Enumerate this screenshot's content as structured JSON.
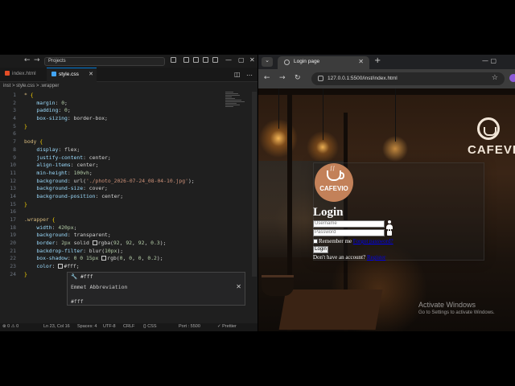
{
  "editor": {
    "search_placeholder": "Projects",
    "tabs": [
      {
        "label": "index.html",
        "icon": "html-file-icon",
        "color": "#e44d26"
      },
      {
        "label": "style.css",
        "icon": "css-file-icon",
        "color": "#42a5f5"
      }
    ],
    "breadcrumb": "inst > style.css > .wrapper",
    "code_lines": [
      {
        "n": "1",
        "t": "* {"
      },
      {
        "n": "2",
        "t": "    margin: 0;"
      },
      {
        "n": "3",
        "t": "    padding: 0;"
      },
      {
        "n": "4",
        "t": "    box-sizing: border-box;"
      },
      {
        "n": "5",
        "t": "}"
      },
      {
        "n": "6",
        "t": ""
      },
      {
        "n": "7",
        "t": "body {"
      },
      {
        "n": "8",
        "t": "    display: flex;"
      },
      {
        "n": "9",
        "t": "    justify-content: center;"
      },
      {
        "n": "10",
        "t": "    align-items: center;"
      },
      {
        "n": "11",
        "t": "    min-height: 100vh;"
      },
      {
        "n": "12",
        "t": "    background: url('./photo_2026-07-24_08-04-10.jpg');"
      },
      {
        "n": "13",
        "t": "    background-size: cover;"
      },
      {
        "n": "14",
        "t": "    background-position: center;"
      },
      {
        "n": "15",
        "t": "}"
      },
      {
        "n": "16",
        "t": ""
      },
      {
        "n": "17",
        "t": ".wrapper {"
      },
      {
        "n": "18",
        "t": "    width: 420px;"
      },
      {
        "n": "19",
        "t": "    background: transparent;"
      },
      {
        "n": "20",
        "t": "    border: 2px solid □rgba(92, 92, 92, 0.3);"
      },
      {
        "n": "21",
        "t": "    backdrop-filter: blur(10px);"
      },
      {
        "n": "22",
        "t": "    box-shadow: 0 0 15px □rgb(0, 0, 0, 0.2);"
      },
      {
        "n": "23",
        "t": "    color: □#fff;"
      },
      {
        "n": "24",
        "t": "}"
      }
    ],
    "emmet": {
      "suggestion": "#fff",
      "title": "Emmet Abbreviation",
      "value": "#fff"
    },
    "status": {
      "left": "⊗ 0 ⚠ 0",
      "position": "Ln 23, Col 16",
      "spaces": "Spaces: 4",
      "encoding": "UTF-8",
      "eol": "CRLF",
      "lang": "{} CSS",
      "port": "Port : 5500",
      "prettier": "✓ Prettier"
    }
  },
  "browser": {
    "tab_title": "Login page",
    "url": "127.0.0.1:5500/inst/index.html",
    "page": {
      "brand": "CAFEVIO",
      "logo_text": "CAFEVIO",
      "heading": "Login",
      "username_placeholder": "Username",
      "password_placeholder": "Password",
      "remember": "Remember me",
      "forgot": "Forgot password?",
      "login_button": "Login",
      "register_prompt": "Don't have an account?",
      "register_link": "Register"
    },
    "watermark": {
      "title": "Activate Windows",
      "subtitle": "Go to Settings to activate Windows."
    }
  }
}
